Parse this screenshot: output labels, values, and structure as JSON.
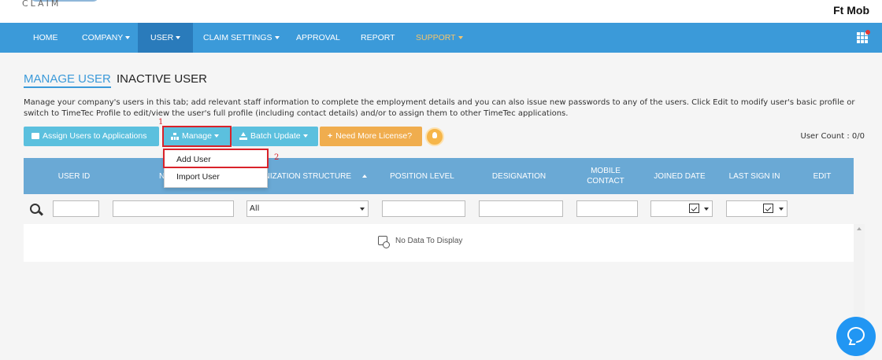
{
  "header": {
    "logo_text": "CLAIM",
    "company_name": "Ft Mob"
  },
  "nav": {
    "items": [
      {
        "label": "HOME"
      },
      {
        "label": "COMPANY"
      },
      {
        "label": "USER"
      },
      {
        "label": "CLAIM SETTINGS"
      },
      {
        "label": "APPROVAL"
      },
      {
        "label": "REPORT"
      },
      {
        "label": "SUPPORT"
      }
    ],
    "active": "USER",
    "apps_icon": "apps-grid-icon",
    "accent_color": "#3b9ad9",
    "active_color": "#2a7bbb",
    "support_color": "#f6c56b"
  },
  "tabs": {
    "active": "MANAGE USER",
    "inactive": "INACTIVE USER"
  },
  "description": "Manage your company's users in this tab; add relevant staff information to complete the employment details and you can also issue new passwords to any of the users. Click Edit to modify user's basic profile or switch to TimeTec Profile to edit/view the user's full profile (including contact details) and/or to assign them to other TimeTec applications.",
  "toolbar": {
    "assign": "Assign Users to Applications",
    "manage": "Manage",
    "batch": "Batch Update",
    "license": "Need More License?",
    "user_count": "User Count : 0/0",
    "annotation_1": "1",
    "annotation_2": "2",
    "highlight_color": "#d9222a"
  },
  "dropdown": {
    "items": [
      "Add User",
      "Import User"
    ]
  },
  "table": {
    "columns": {
      "user_id": "USER ID",
      "name": "N",
      "org": "ANIZATION STRUCTURE",
      "position": "POSITION LEVEL",
      "designation": "DESIGNATION",
      "mobile_1": "MOBILE",
      "mobile_2": "CONTACT",
      "joined": "JOINED DATE",
      "last_sign": "LAST SIGN IN",
      "edit": "EDIT"
    },
    "filters": {
      "org_select": "All"
    },
    "empty_text": "No Data To Display",
    "header_color": "#6aa9d5"
  }
}
